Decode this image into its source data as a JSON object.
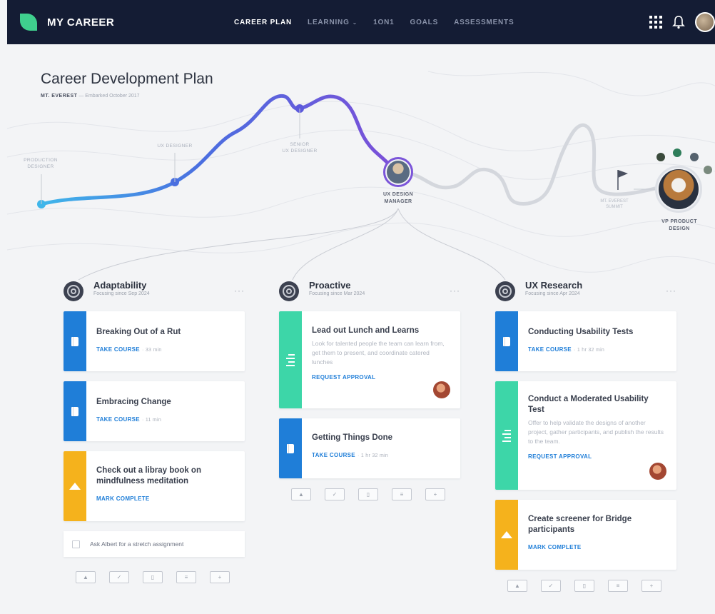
{
  "app": {
    "brand": "MY CAREER",
    "nav": [
      {
        "label": "CAREER PLAN",
        "active": true
      },
      {
        "label": "LEARNING",
        "dropdown": true
      },
      {
        "label": "1ON1"
      },
      {
        "label": "GOALS"
      },
      {
        "label": "ASSESSMENTS"
      }
    ],
    "icons": [
      "apps-grid-icon",
      "bell-icon",
      "user-avatar"
    ]
  },
  "hero": {
    "title": "Career Development Plan",
    "sub_bold": "MT. EVEREST",
    "sub_rest": "— Embarked October 2017",
    "milestones": [
      {
        "line1": "PRODUCTION",
        "line2": "DESIGNER"
      },
      {
        "line1": "UX DESIGNER",
        "line2": ""
      },
      {
        "line1": "SENIOR",
        "line2": "UX DESIGNER"
      }
    ],
    "current": {
      "line1": "UX DESIGN",
      "line2": "MANAGER"
    },
    "goal": {
      "line1": "VP PRODUCT",
      "line2": "DESIGN"
    },
    "flag": {
      "line1": "MT. EVEREST",
      "line2": "SUMMIT"
    }
  },
  "columns": [
    {
      "title": "Adaptability",
      "since": "Focusing since Sep 2024",
      "more": "···",
      "cards": [
        {
          "type": "course",
          "title": "Breaking Out of a Rut",
          "action": "TAKE COURSE",
          "meta": "· 33 min"
        },
        {
          "type": "course",
          "title": "Embracing Change",
          "action": "TAKE COURSE",
          "meta": "· 11 min"
        },
        {
          "type": "activity",
          "title": "Check out a libray book on mindfulness meditation",
          "action": "MARK COMPLETE"
        }
      ],
      "task": "Ask Albert for a stretch assignment"
    },
    {
      "title": "Proactive",
      "since": "Focusing since Mar 2024",
      "more": "···",
      "cards": [
        {
          "type": "approval",
          "title": "Lead out Lunch and Learns",
          "desc": "Look for talented people the team can learn from, get them to present, and coordinate catered lunches",
          "action": "REQUEST APPROVAL"
        },
        {
          "type": "course",
          "title": "Getting Things Done",
          "action": "TAKE COURSE",
          "meta": "· 1 hr 32 min"
        }
      ]
    },
    {
      "title": "UX Research",
      "since": "Focusing since Apr 2024",
      "more": "···",
      "cards": [
        {
          "type": "course",
          "title": "Conducting Usability Tests",
          "action": "TAKE COURSE",
          "meta": "· 1 hr 32 min"
        },
        {
          "type": "approval",
          "title": "Conduct a Moderated Usability Test",
          "desc": "Offer to help validate the designs of another project, gather participants, and publish the results to the team.",
          "action": "REQUEST APPROVAL"
        },
        {
          "type": "activity",
          "title": "Create screener for Bridge participants",
          "action": "MARK COMPLETE"
        }
      ]
    }
  ],
  "add_buttons": [
    "▲",
    "✓",
    "▯",
    "≡",
    "+"
  ],
  "colors": {
    "nav_bg": "#141c34",
    "accent_blue": "#1f7ed8",
    "accent_green": "#3dd6a8",
    "accent_yellow": "#f5b21c",
    "path_purple": "#6b4fd8",
    "path_blue": "#3fa9e8"
  }
}
